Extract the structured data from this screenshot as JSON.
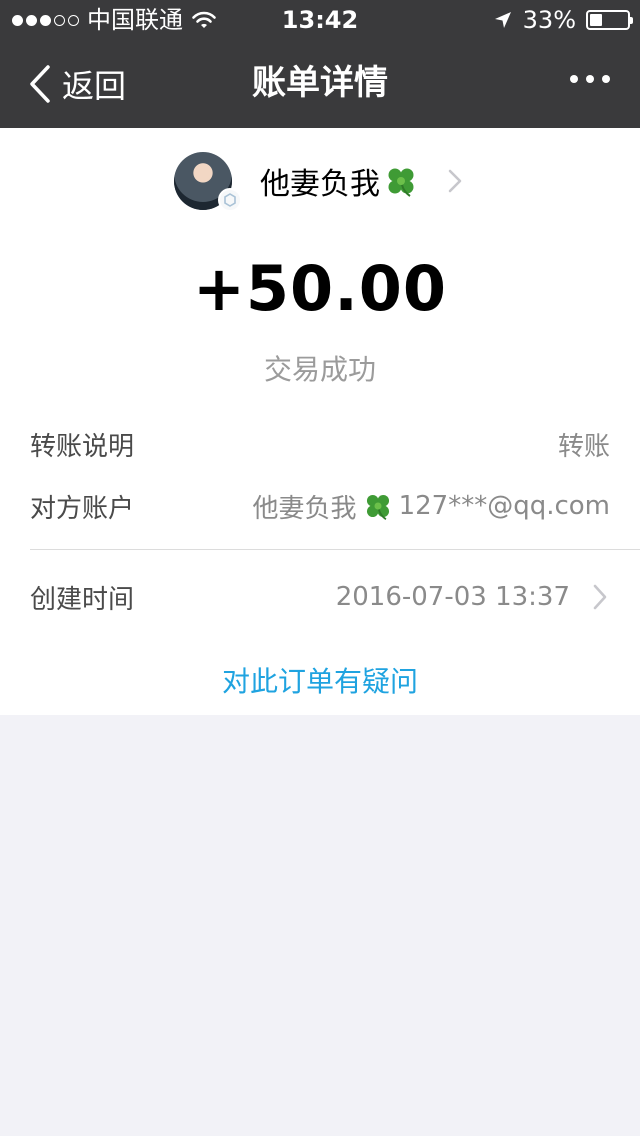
{
  "status_bar": {
    "carrier": "中国联通",
    "time": "13:42",
    "battery_percent": "33%",
    "battery_level": 0.33,
    "signal_bars_filled": 3,
    "signal_bars_total": 5,
    "icons": [
      "signal-dots-icon",
      "wifi-icon",
      "location-arrow-icon",
      "battery-icon"
    ]
  },
  "nav": {
    "back_label": "返回",
    "title": "账单详情",
    "more_icon": "more-dots-icon"
  },
  "payee": {
    "name": "他妻负我",
    "name_emoji": "clover",
    "avatar_icon": "avatar-image",
    "badge_icon": "verified-badge-icon"
  },
  "transaction": {
    "amount": "+50.00",
    "status": "交易成功"
  },
  "details": [
    {
      "label": "转账说明",
      "value": "转账"
    },
    {
      "label": "对方账户",
      "value_name": "他妻负我",
      "value_account": "127***@qq.com"
    },
    {
      "label": "创建时间",
      "value": "2016-07-03 13:37"
    }
  ],
  "question_link": "对此订单有疑问",
  "colors": {
    "nav_bg": "#3a3a3c",
    "page_bg": "#f2f2f7",
    "link": "#1fa3e0",
    "muted": "#8a8a8a"
  }
}
